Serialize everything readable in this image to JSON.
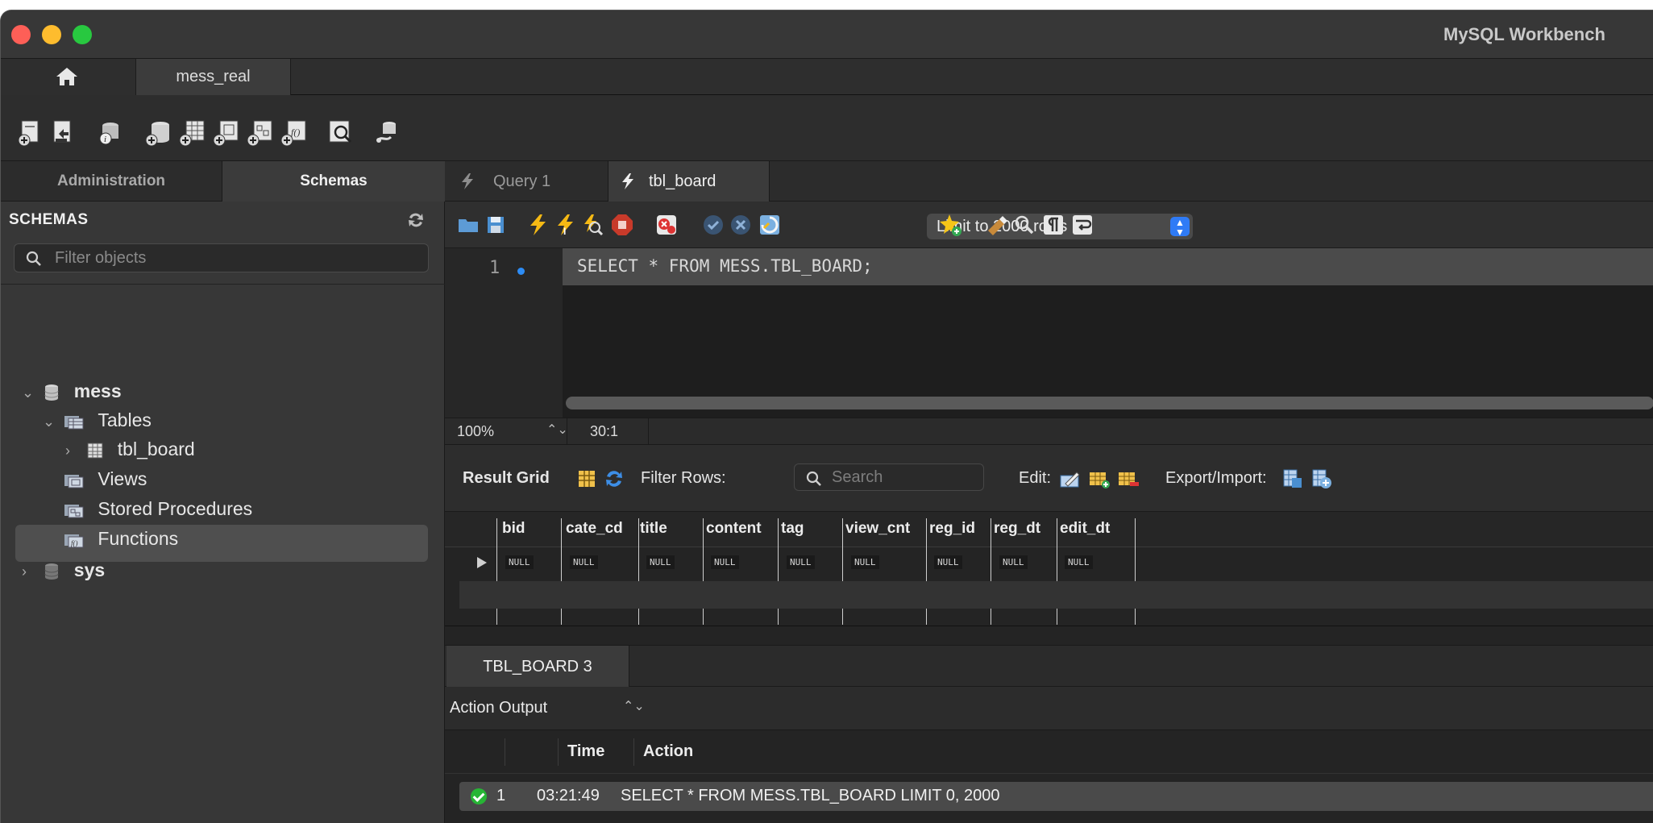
{
  "window": {
    "title": "MySQL Workbench"
  },
  "connection_tabs": {
    "home_icon": "home-icon",
    "active": "mess_real"
  },
  "toolbar": {
    "icons": [
      "new-sql-tab-icon",
      "open-sql-script-icon",
      "inspector-icon",
      "create-schema-icon",
      "create-table-icon",
      "create-view-icon",
      "create-procedure-icon",
      "create-function-icon",
      "table-search-icon",
      "reconnect-icon"
    ]
  },
  "sidebar": {
    "tabs": [
      "Administration",
      "Schemas"
    ],
    "active_tab": "Schemas",
    "header": "SCHEMAS",
    "filter_placeholder": "Filter objects",
    "tree": {
      "schema1": "mess",
      "tables": "Tables",
      "table1": "tbl_board",
      "views": "Views",
      "procedures": "Stored Procedures",
      "functions": "Functions",
      "schema2": "sys"
    }
  },
  "query_tabs": {
    "tab1": "Query 1",
    "tab2": "tbl_board"
  },
  "sql_toolbar": {
    "limit": "Limit to 2000 rows"
  },
  "editor": {
    "line_number": "1",
    "code": "SELECT * FROM MESS.TBL_BOARD;",
    "zoom": "100%",
    "cursor": "30:1"
  },
  "result_toolbar": {
    "result_grid": "Result Grid",
    "filter_rows": "Filter Rows:",
    "search_placeholder": "Search",
    "edit": "Edit:",
    "export_import": "Export/Import:"
  },
  "grid": {
    "columns": [
      "bid",
      "cate_cd",
      "title",
      "content",
      "tag",
      "view_cnt",
      "reg_id",
      "reg_dt",
      "edit_dt"
    ],
    "null_label": "NULL"
  },
  "output": {
    "tab": "TBL_BOARD 3",
    "selector": "Action Output",
    "headers": {
      "time": "Time",
      "action": "Action"
    },
    "rows": [
      {
        "index": "1",
        "time": "03:21:49",
        "action": "SELECT * FROM MESS.TBL_BOARD LIMIT 0, 2000",
        "status": "success"
      }
    ]
  },
  "colors": {
    "accent": "#2f7bf6",
    "success": "#27b535",
    "bg": "#2b2b2b"
  }
}
